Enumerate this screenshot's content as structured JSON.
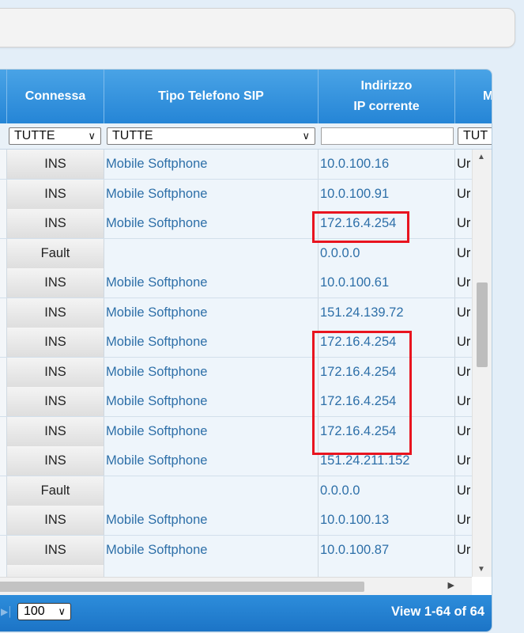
{
  "columns": {
    "connessa": "Connessa",
    "tipo_telefono": "Tipo Telefono SIP",
    "indirizzo_line1": "Indirizzo",
    "indirizzo_line2": "IP corrente",
    "partial": "M"
  },
  "filters": {
    "connessa": "TUTTE",
    "tipo_telefono": "TUTTE",
    "indirizzo": "",
    "partial": "TUT"
  },
  "rows": [
    {
      "connessa": "INS",
      "tipo": "Mobile Softphone",
      "ip": "10.0.100.16",
      "m": "Ur"
    },
    {
      "connessa": "INS",
      "tipo": "Mobile Softphone",
      "ip": "10.0.100.91",
      "m": "Ur"
    },
    {
      "connessa": "INS",
      "tipo": "Mobile Softphone",
      "ip": "172.16.4.254",
      "m": "Ur"
    },
    {
      "connessa": "Fault",
      "tipo": "",
      "ip": "0.0.0.0",
      "m": "Ur"
    },
    {
      "connessa": "INS",
      "tipo": "Mobile Softphone",
      "ip": "10.0.100.61",
      "m": "Ur"
    },
    {
      "connessa": "INS",
      "tipo": "Mobile Softphone",
      "ip": "151.24.139.72",
      "m": "Ur"
    },
    {
      "connessa": "INS",
      "tipo": "Mobile Softphone",
      "ip": "172.16.4.254",
      "m": "Ur"
    },
    {
      "connessa": "INS",
      "tipo": "Mobile Softphone",
      "ip": "172.16.4.254",
      "m": "Ur"
    },
    {
      "connessa": "INS",
      "tipo": "Mobile Softphone",
      "ip": "172.16.4.254",
      "m": "Ur"
    },
    {
      "connessa": "INS",
      "tipo": "Mobile Softphone",
      "ip": "172.16.4.254",
      "m": "Ur"
    },
    {
      "connessa": "INS",
      "tipo": "Mobile Softphone",
      "ip": "151.24.211.152",
      "m": "Ur"
    },
    {
      "connessa": "Fault",
      "tipo": "",
      "ip": "0.0.0.0",
      "m": "Ur"
    },
    {
      "connessa": "INS",
      "tipo": "Mobile Softphone",
      "ip": "10.0.100.13",
      "m": "Ur"
    },
    {
      "connessa": "INS",
      "tipo": "Mobile Softphone",
      "ip": "10.0.100.87",
      "m": "Ur"
    }
  ],
  "pager": {
    "page_size": "100",
    "view_text": "View 1-64 of 64"
  },
  "colors": {
    "header_blue": "#2585d6",
    "link_blue": "#2d6fa8",
    "highlight_red": "#e8141f"
  }
}
